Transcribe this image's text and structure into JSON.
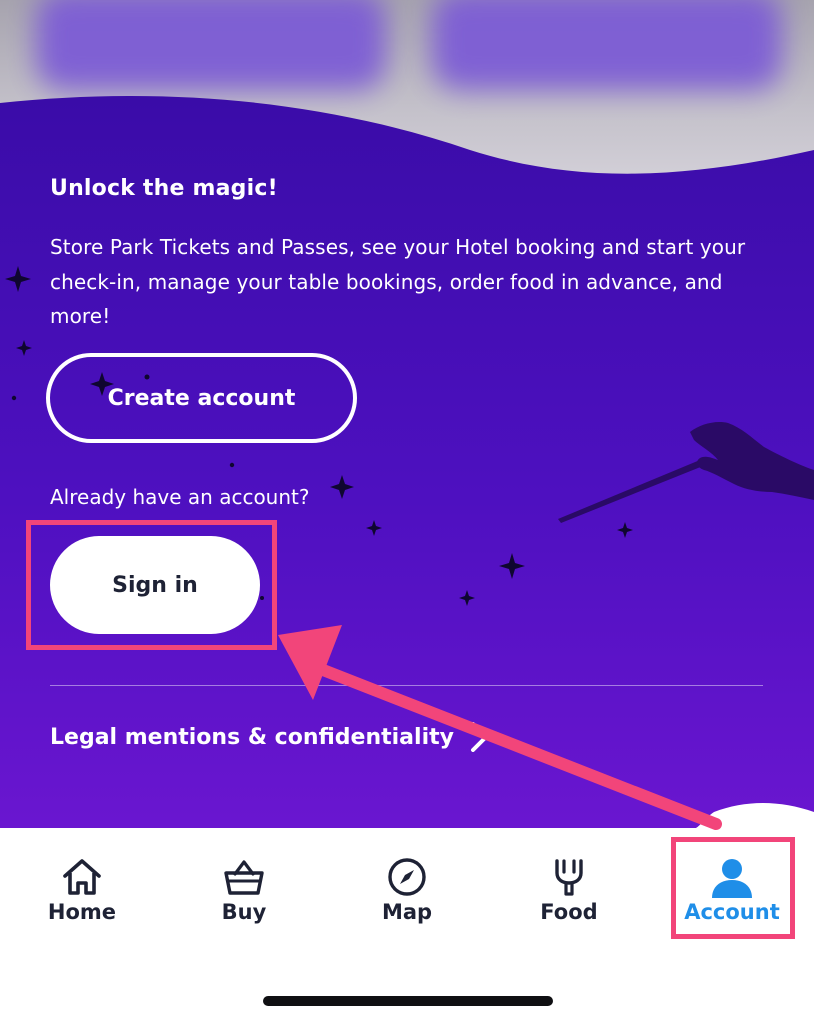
{
  "colors": {
    "purple_dark": "#3a0ca8",
    "purple_light": "#6a16d0",
    "accent_blue": "#1f8ee8",
    "text_dark": "#1e2235",
    "annotation_pink": "#f2457a"
  },
  "promo": {
    "headline": "Unlock the magic!",
    "description": "Store Park Tickets and Passes, see your Hotel booking and start your check-in, manage your table bookings, order food in advance, and more!",
    "create_account_label": "Create account",
    "already_label": "Already have an account?",
    "sign_in_label": "Sign in"
  },
  "legal": {
    "label": "Legal mentions & confidentiality",
    "icon": "chevron-right-icon"
  },
  "tabbar": {
    "tabs": [
      {
        "label": "Home",
        "icon": "home-icon",
        "active": false
      },
      {
        "label": "Buy",
        "icon": "basket-icon",
        "active": false
      },
      {
        "label": "Map",
        "icon": "compass-icon",
        "active": false
      },
      {
        "label": "Food",
        "icon": "fork-icon",
        "active": false
      },
      {
        "label": "Account",
        "icon": "person-icon",
        "active": true
      }
    ]
  }
}
